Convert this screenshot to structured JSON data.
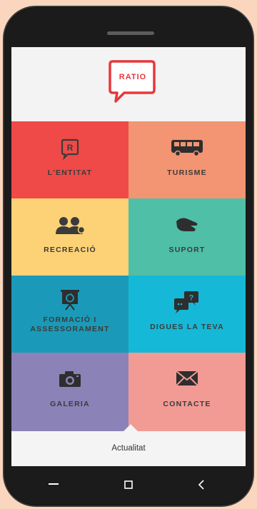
{
  "logo": {
    "text": "RATIO",
    "color": "#e8373b"
  },
  "tiles": [
    {
      "label": "L'ENTITAT",
      "icon": "r-logo-icon",
      "color": "#ef4a48"
    },
    {
      "label": "TURISME",
      "icon": "bus-icon",
      "color": "#f39472"
    },
    {
      "label": "RECREACIÓ",
      "icon": "people-icon",
      "color": "#fdd276"
    },
    {
      "label": "SUPORT",
      "icon": "hand-icon",
      "color": "#4fbfa7"
    },
    {
      "label_line1": "FORMACIÓ I",
      "label_line2": "ASSESSORAMENT",
      "icon": "presentation-icon",
      "color": "#1a9ab8"
    },
    {
      "label": "DIGUES LA TEVA",
      "icon": "chat-question-icon",
      "color": "#15b8d6"
    },
    {
      "label": "GALERIA",
      "icon": "camera-icon",
      "color": "#8b82b8"
    },
    {
      "label": "CONTACTE",
      "icon": "envelope-icon",
      "color": "#f19b94"
    }
  ],
  "bottom_tab": {
    "label": "Actualitat"
  },
  "navbar": {
    "back": "back-icon",
    "home": "home-icon",
    "recent": "recent-apps-icon"
  }
}
